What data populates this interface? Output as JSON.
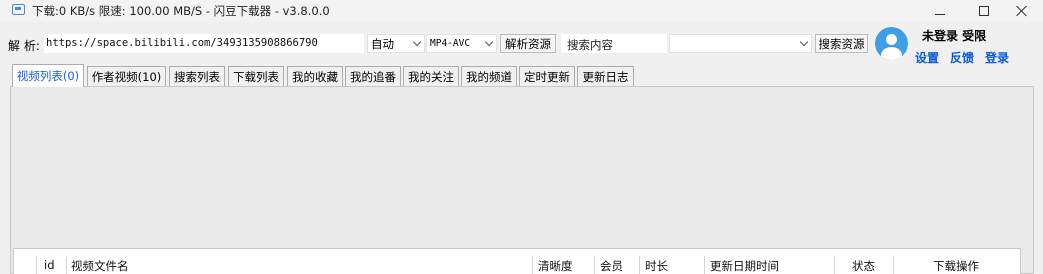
{
  "window": {
    "title": "下载:0 KB/s  限速: 100.00 MB/S  - 闪豆下载器 - v3.8.0.0"
  },
  "toolbar": {
    "parse_label": "解 析:",
    "url_value": "https://space.bilibili.com/3493135908866790",
    "mode_value": "自动",
    "format_value": "MP4-AVC",
    "parse_button": "解析资源",
    "search_value": "搜索内容",
    "search_combo_value": "",
    "search_button": "搜索资源"
  },
  "user": {
    "status": "未登录 受限",
    "settings": "设置",
    "feedback": "反馈",
    "login": "登录"
  },
  "tabs": [
    {
      "label": "视频列表(0)",
      "active": true
    },
    {
      "label": "作者视频(10)"
    },
    {
      "label": "搜索列表"
    },
    {
      "label": "下载列表"
    },
    {
      "label": "我的收藏"
    },
    {
      "label": "我的追番"
    },
    {
      "label": "我的关注"
    },
    {
      "label": "我的频道"
    },
    {
      "label": "定时更新"
    },
    {
      "label": "更新日志"
    }
  ],
  "table": {
    "columns": [
      "id",
      "视频文件名",
      "清晰度",
      "会员",
      "时长",
      "更新日期时间",
      "状态",
      "下载操作"
    ]
  }
}
